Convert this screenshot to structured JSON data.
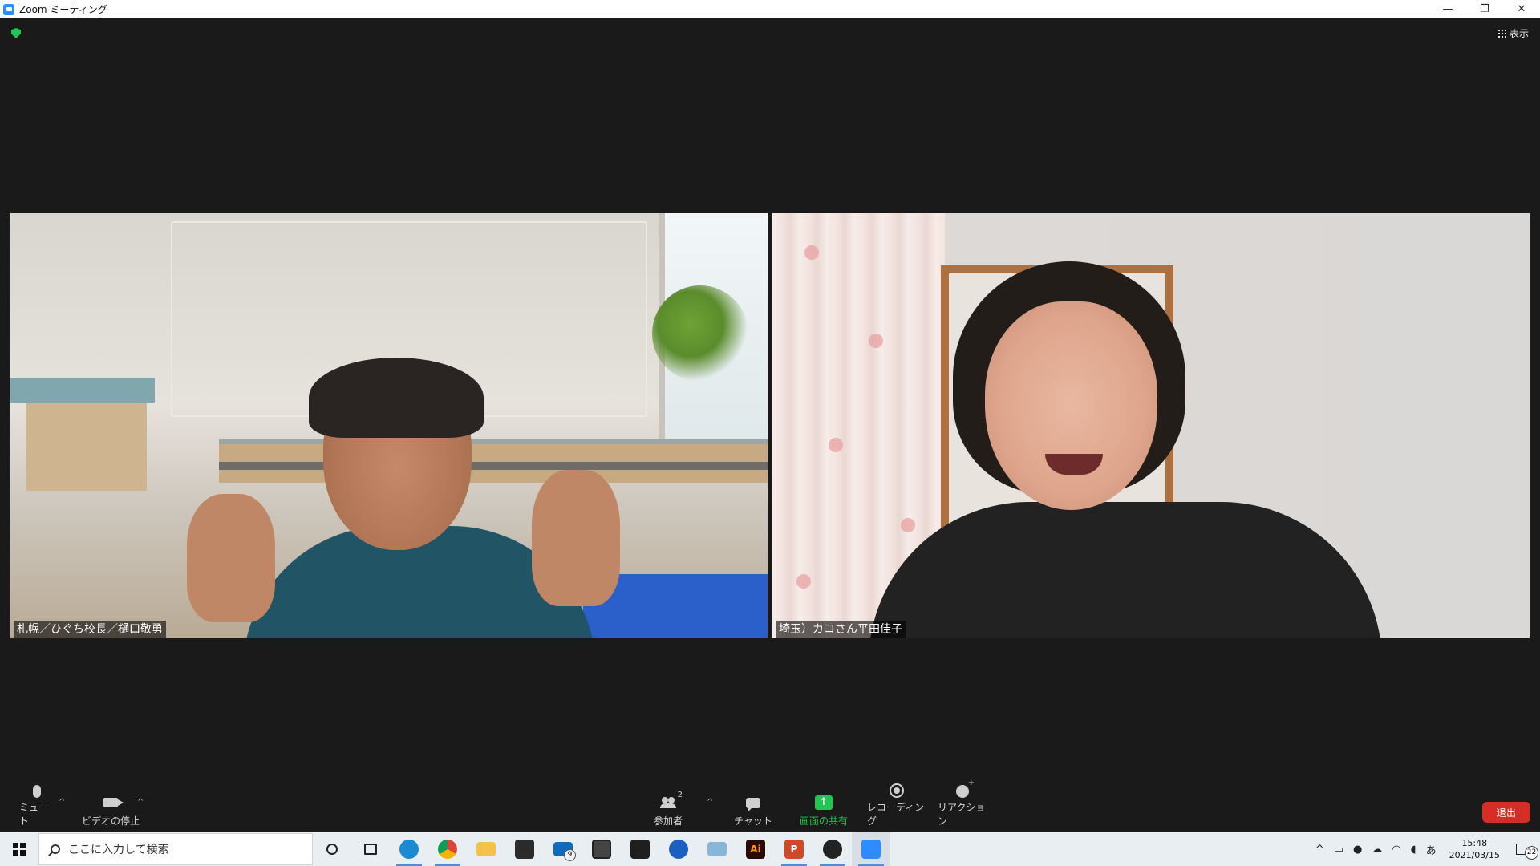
{
  "titlebar": {
    "title": "Zoom ミーティング",
    "minimize": "—",
    "restore": "❐",
    "close": "✕"
  },
  "meeting": {
    "view_label": "表示",
    "participants": [
      {
        "name": "札幌／ひぐち校長／樋口敬勇"
      },
      {
        "name": "埼玉）カコさん平田佳子"
      }
    ]
  },
  "controls": {
    "mute_label": "ミュート",
    "video_label": "ビデオの停止",
    "participants_label": "参加者",
    "participants_count": "2",
    "chat_label": "チャット",
    "share_label": "画面の共有",
    "share_icon": "↑",
    "record_label": "レコーディング",
    "reaction_label": "リアクション",
    "caret": "^",
    "end_label": "退出",
    "colors": {
      "share_green": "#23c552",
      "end_red": "#d42e27"
    }
  },
  "taskbar": {
    "search_placeholder": "ここに入力して検索",
    "apps": [
      {
        "icon": "cortana-icon"
      },
      {
        "icon": "task-view-icon"
      },
      {
        "icon": "edge-icon"
      },
      {
        "icon": "chrome-icon"
      },
      {
        "icon": "file-explorer-icon"
      },
      {
        "icon": "store-icon"
      },
      {
        "icon": "mail-icon",
        "badge": "9"
      },
      {
        "icon": "snip-icon"
      },
      {
        "icon": "media-icon"
      },
      {
        "icon": "app-blue-icon"
      },
      {
        "icon": "app-folder-icon"
      },
      {
        "icon": "illustrator-icon",
        "label": "Ai"
      },
      {
        "icon": "powerpoint-icon",
        "label": "P"
      },
      {
        "icon": "pen-app-icon"
      },
      {
        "icon": "zoom-icon"
      }
    ],
    "tray": {
      "ime": "あ",
      "time": "15:48",
      "date": "2021/03/15",
      "notifications": "22"
    }
  }
}
